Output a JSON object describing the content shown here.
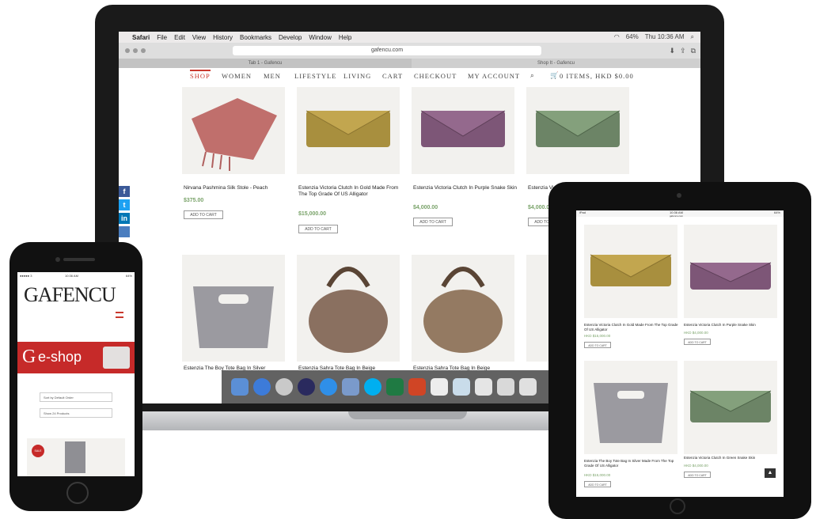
{
  "laptop": {
    "menubar": {
      "apple": "",
      "items": [
        "Safari",
        "File",
        "Edit",
        "View",
        "History",
        "Bookmarks",
        "Develop",
        "Window",
        "Help"
      ],
      "battery": "64%",
      "clock": "Thu 10:36 AM"
    },
    "toolbar": {
      "url": "gafencu.com"
    },
    "tabs": [
      "Tab 1 - Gafencu",
      "Shop It - Gafencu"
    ],
    "nav": {
      "items": [
        "SHOP",
        "WOMEN",
        "MEN",
        "LIFESTYLE",
        "LIVING",
        "CART",
        "CHECKOUT",
        "MY ACCOUNT"
      ],
      "cart_summary": "0 ITEMS, HKD $0.00"
    },
    "products": [
      {
        "name": "Nirvana Pashmina Silk Stole - Peach",
        "price": "$375.00",
        "button": "ADD TO CART"
      },
      {
        "name": "Estenzia Victoria Clutch In Gold Made From The Top Grade Of US Alligator",
        "price": "$15,000.00",
        "button": "ADD TO CART"
      },
      {
        "name": "Estenzia Victoria Clutch In Purple Snake Skin",
        "price": "$4,000.00",
        "button": "ADD TO CART"
      },
      {
        "name": "Estenzia Victoria Clutch In Green Snake Skin",
        "price": "$4,000.00",
        "button": "ADD TO CART"
      }
    ],
    "products_row2": [
      {
        "name": "Estenzia The Boy Tote Bag In Silver"
      },
      {
        "name": "Estenzia Sahra Tote Bag In Beige"
      },
      {
        "name": "Estenzia Sahra Tote Bag In Beige"
      }
    ],
    "social": [
      "f",
      "t",
      "in"
    ]
  },
  "ipad": {
    "status": {
      "left": "iPad",
      "center": "10:36 AM",
      "right": "64%"
    },
    "url": "gafencu.com",
    "products": [
      {
        "name": "Estenzia Victoria Clutch In Gold Made From The Top Grade Of US Alligator",
        "price": "HKD $15,000.00",
        "button": "ADD TO CART"
      },
      {
        "name": "Estenzia Victoria Clutch In Purple Snake Skin",
        "price": "HKD $4,000.00",
        "button": "ADD TO CART"
      },
      {
        "name": "Estenzia The Boy Tote Bag In Silver Made From The Top Grade Of US Alligator",
        "price": "HKD $15,000.00",
        "button": "ADD TO CART"
      },
      {
        "name": "Estenzia Victoria Clutch In Green Snake Skin",
        "price": "HKD $4,000.00",
        "button": "ADD TO CART"
      }
    ]
  },
  "phone": {
    "status": {
      "left": "●●●●● 3",
      "center": "10:36 AM",
      "right": "64%"
    },
    "logo": "GAFENCU",
    "banner": "e-shop",
    "sort": "Sort by Default Order",
    "show": "Show 24 Products",
    "badge": "SALE"
  }
}
